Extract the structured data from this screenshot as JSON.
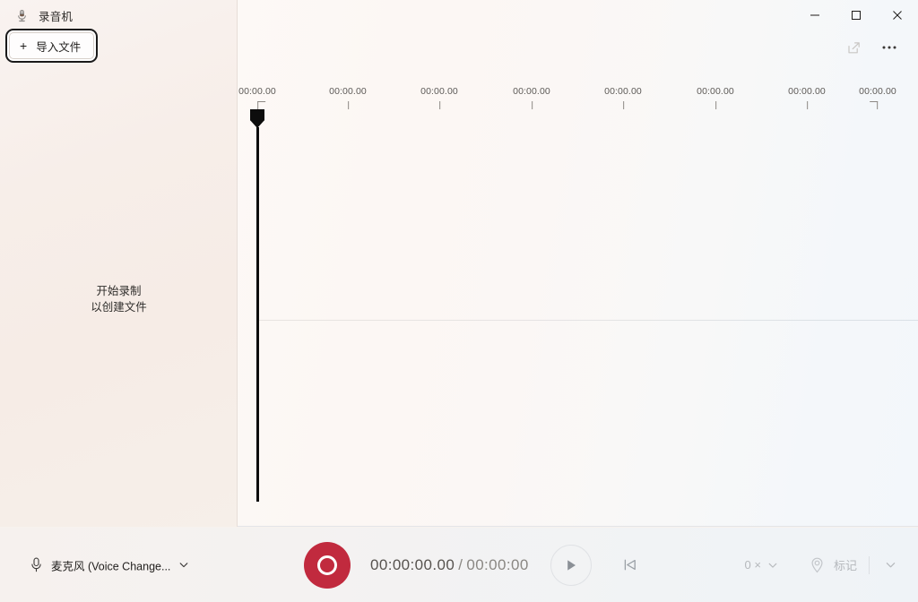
{
  "window": {
    "app_title": "录音机",
    "app_icon": "microphone-icon",
    "controls": {
      "minimize": "—",
      "maximize": "▢",
      "close": "✕"
    }
  },
  "sidebar": {
    "import_button": {
      "label": "导入文件",
      "plus": "+"
    },
    "empty_state": {
      "line1": "开始录制",
      "line2": "以创建文件"
    }
  },
  "main_toolbar": {
    "share_label": "share-icon",
    "more_label": "more-options-icon",
    "more_glyph": "···"
  },
  "timeline": {
    "labels": [
      "00:00.00",
      "00:00.00",
      "00:00.00",
      "00:00.00",
      "00:00.00",
      "00:00.00",
      "00:00.00",
      "00:00.00"
    ],
    "playhead_position": "00:00.00"
  },
  "transport": {
    "mic_device": "麦克风 (Voice Change...",
    "record_label": "record-button",
    "current_time": "00:00:00.00",
    "separator": "/",
    "total_time": "00:00:00",
    "play_label": "play-button",
    "skip_to_start_label": "skip-to-start-button",
    "speed_value": "0 ×",
    "mark_label": "标记"
  },
  "colors": {
    "record_red": "#c12a3e",
    "sidebar_bg": "#f7eee9",
    "main_bg": "#fbf7f5",
    "playhead": "#0d0d0d",
    "disabled_text": "#b5b8bc"
  }
}
